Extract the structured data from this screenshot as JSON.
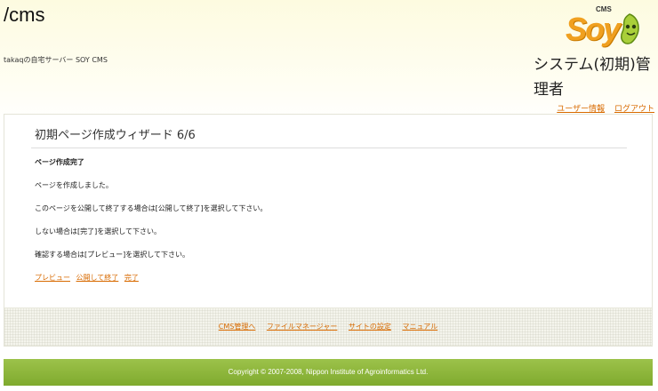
{
  "header": {
    "title": "/cms",
    "subtitle": "takaqの自宅サーバー SOY CMS",
    "logo_text": "Soy",
    "logo_cms": "CMS",
    "role_line1": "システム(初期)管",
    "role_line2": "理者",
    "user_info_link": "ユーザー情報",
    "logout_link": "ログアウト"
  },
  "wizard": {
    "title": "初期ページ作成ウィザード 6/6",
    "section_title": "ページ作成完了",
    "lines": [
      "ページを作成しました。",
      "このページを公開して終了する場合は[公開して終了]を選択して下さい。",
      "しない場合は[完了]を選択して下さい。",
      "確認する場合は[プレビュー]を選択して下さい。"
    ],
    "actions": {
      "preview": "プレビュー",
      "publish": "公開して終了",
      "finish": "完了"
    }
  },
  "footer_links": {
    "cms_admin": "CMS管理へ",
    "file_manager": "ファイルマネージャー",
    "site_settings": "サイトの設定",
    "manual": "マニュアル"
  },
  "copyright": "Copyright © 2007-2008, Nippon Institute of Agroinformatics Ltd.",
  "colors": {
    "link": "#d86a00",
    "footer_bar": "#8cb63c",
    "logo_orange": "#f0a020"
  }
}
